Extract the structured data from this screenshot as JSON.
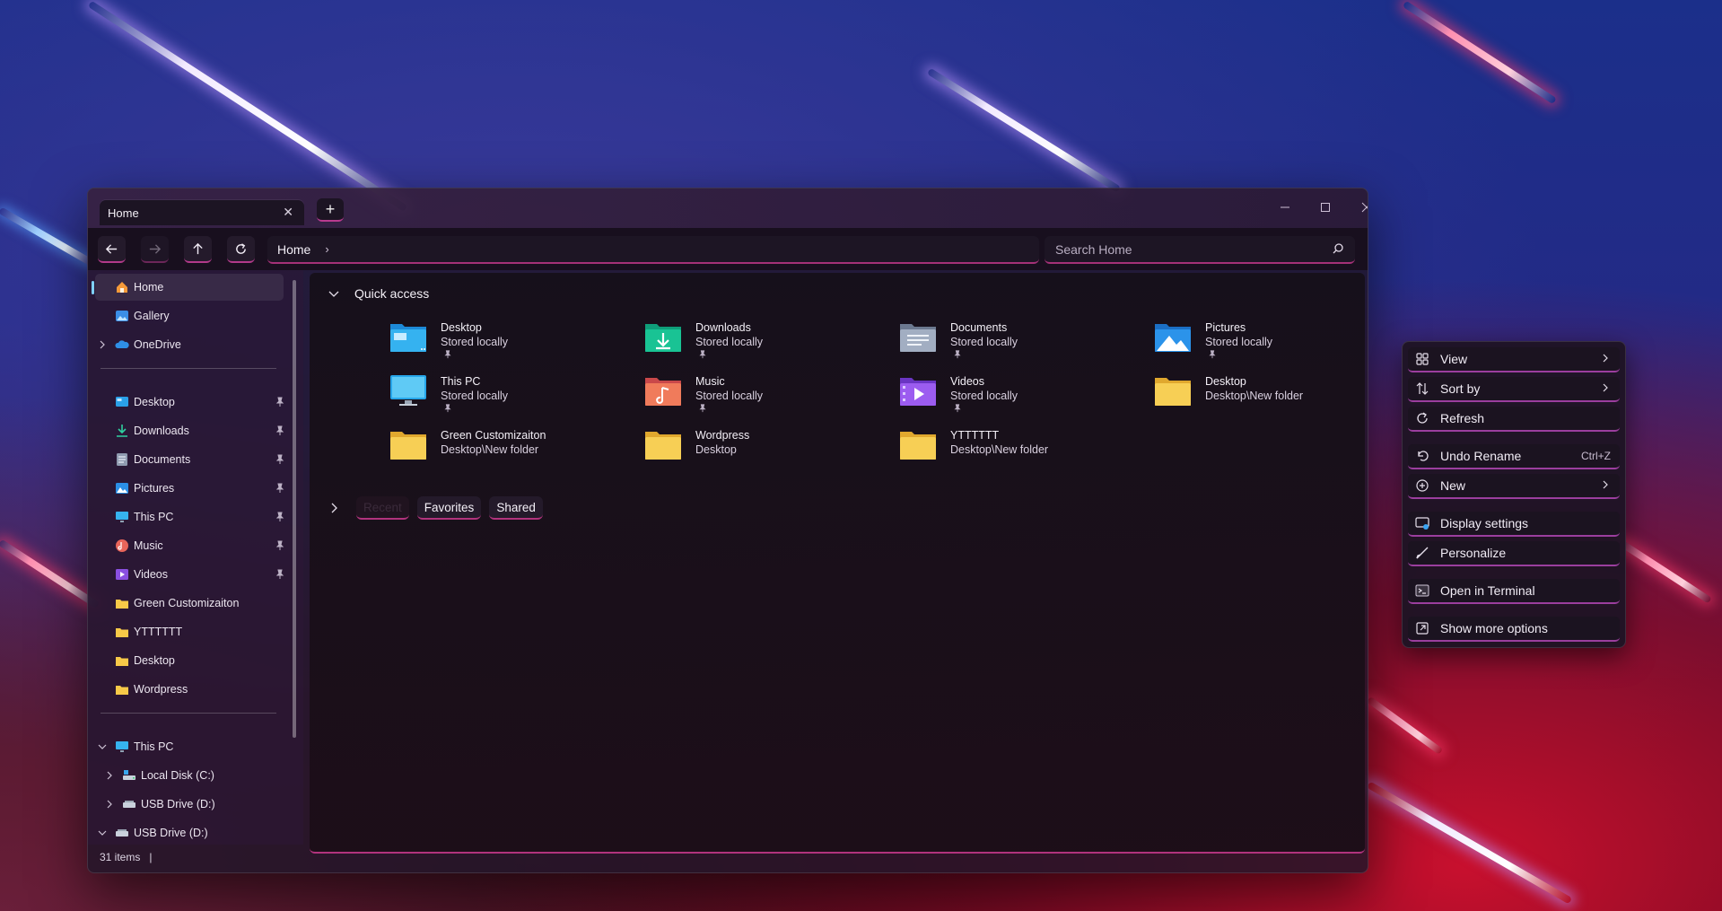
{
  "window": {
    "tab_title": "Home",
    "new_tab_symbol": "+"
  },
  "navigation": {
    "address": "Home",
    "address_separator": "›",
    "search_placeholder": "Search Home"
  },
  "sidebar": {
    "top": [
      {
        "label": "Home",
        "icon": "home-icon",
        "selected": true
      },
      {
        "label": "Gallery",
        "icon": "gallery-icon"
      },
      {
        "label": "OneDrive",
        "icon": "onedrive-icon"
      }
    ],
    "pinned": [
      {
        "label": "Desktop",
        "icon": "desktop-icon"
      },
      {
        "label": "Downloads",
        "icon": "downloads-icon"
      },
      {
        "label": "Documents",
        "icon": "documents-icon"
      },
      {
        "label": "Pictures",
        "icon": "pictures-icon"
      },
      {
        "label": "This PC",
        "icon": "this-pc-icon"
      },
      {
        "label": "Music",
        "icon": "music-icon"
      },
      {
        "label": "Videos",
        "icon": "videos-icon"
      }
    ],
    "folders": [
      {
        "label": "Green Customizaiton",
        "icon": "folder-icon"
      },
      {
        "label": "YTTTTTT",
        "icon": "folder-icon"
      },
      {
        "label": "Desktop",
        "icon": "folder-icon"
      },
      {
        "label": "Wordpress",
        "icon": "folder-icon"
      }
    ],
    "drives": [
      {
        "label": "This PC",
        "icon": "this-pc-icon"
      },
      {
        "label": "Local Disk (C:)",
        "icon": "drive-icon"
      },
      {
        "label": "USB Drive (D:)",
        "icon": "usb-drive-icon"
      },
      {
        "label": "USB Drive (D:)",
        "icon": "usb-drive-icon"
      }
    ]
  },
  "status": {
    "items_count": "31 items",
    "separator": "|"
  },
  "quick_access": {
    "heading": "Quick access",
    "items": [
      {
        "name": "Desktop",
        "sub": "Stored locally",
        "icon": "desktop-folder-icon",
        "pinned": true
      },
      {
        "name": "Downloads",
        "sub": "Stored locally",
        "icon": "downloads-folder-icon",
        "pinned": true
      },
      {
        "name": "Documents",
        "sub": "Stored locally",
        "icon": "documents-folder-icon",
        "pinned": true
      },
      {
        "name": "Pictures",
        "sub": "Stored locally",
        "icon": "pictures-folder-icon",
        "pinned": true
      },
      {
        "name": "This PC",
        "sub": "Stored locally",
        "icon": "this-pc-icon",
        "pinned": true
      },
      {
        "name": "Music",
        "sub": "Stored locally",
        "icon": "music-folder-icon",
        "pinned": true
      },
      {
        "name": "Videos",
        "sub": "Stored locally",
        "icon": "videos-folder-icon",
        "pinned": true
      },
      {
        "name": "Desktop",
        "sub": "Desktop\\New folder",
        "icon": "folder-icon",
        "pinned": false
      },
      {
        "name": "Green Customizaiton",
        "sub": "Desktop\\New folder",
        "icon": "folder-icon",
        "pinned": false
      },
      {
        "name": "Wordpress",
        "sub": "Desktop",
        "icon": "folder-icon",
        "pinned": false
      },
      {
        "name": "YTTTTTT",
        "sub": "Desktop\\New folder",
        "icon": "folder-icon",
        "pinned": false
      }
    ]
  },
  "filter_chips": [
    "Recent",
    "Favorites",
    "Shared"
  ],
  "context_menu": {
    "items": [
      {
        "label": "View",
        "icon": "view-grid-icon",
        "submenu": true
      },
      {
        "label": "Sort by",
        "icon": "sort-icon",
        "submenu": true
      },
      {
        "label": "Refresh",
        "icon": "refresh-icon"
      },
      {
        "label": "Undo Rename",
        "icon": "undo-icon",
        "shortcut": "Ctrl+Z"
      },
      {
        "label": "New",
        "icon": "new-plus-icon",
        "submenu": true
      },
      {
        "label": "Display settings",
        "icon": "display-settings-icon"
      },
      {
        "label": "Personalize",
        "icon": "personalize-brush-icon"
      },
      {
        "label": "Open in Terminal",
        "icon": "terminal-icon"
      },
      {
        "label": "Show more options",
        "icon": "show-more-options-icon"
      }
    ]
  },
  "colors": {
    "accent_underline": "#b1337d",
    "selection_indicator": "#7fd0ff",
    "folder_yellow": "#f7c948"
  }
}
